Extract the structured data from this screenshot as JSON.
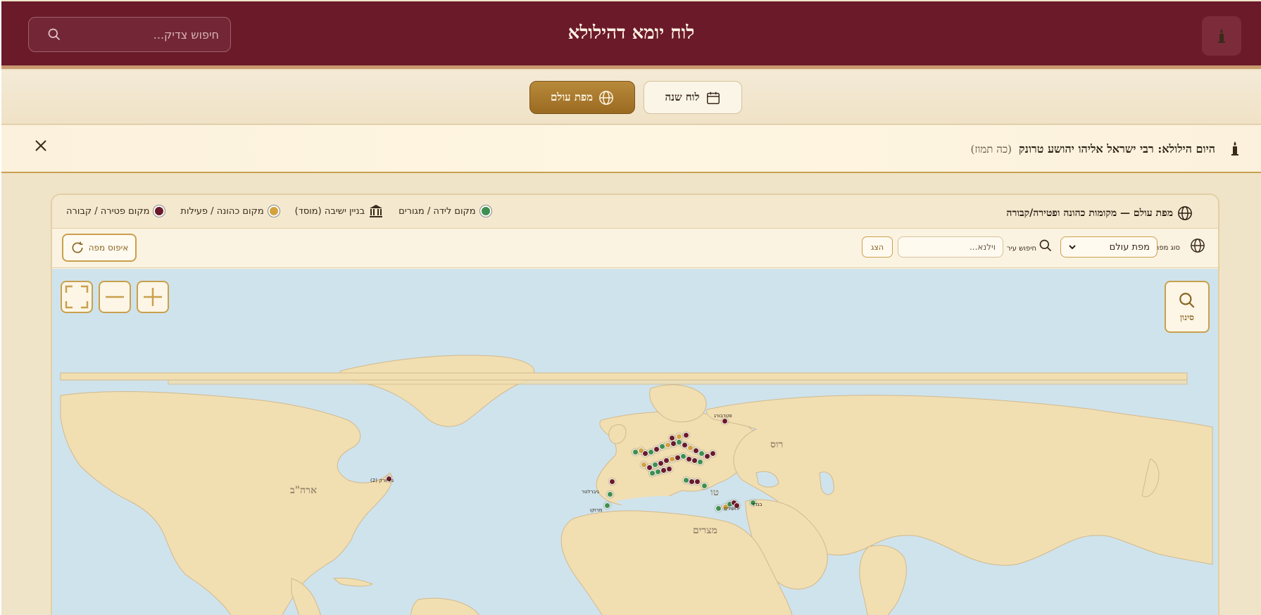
{
  "header": {
    "title": "לוח יומא דהילולא",
    "search_placeholder": "חיפוש צדיק..."
  },
  "nav": {
    "world_map": "מפת עולם",
    "year_calendar": "לוח שנה"
  },
  "announcement": {
    "label": "היום הילולא: רבי ישראל אליהו יהושע טרונק",
    "hebrew_date": "(כה תמוז)"
  },
  "card": {
    "title": "מפת עולם — מקומות כהונה ופטירה/קבורה",
    "legend": [
      {
        "label": "מקום לידה / מגורים",
        "color": "#3f8f4e"
      },
      {
        "label": "בניין ישיבה (מוסד)",
        "color": "icon-building"
      },
      {
        "label": "מקום כהונה / פעילות",
        "color": "#d4a23c"
      },
      {
        "label": "מקום פטירה / קבורה",
        "color": "#6b1a2a"
      }
    ]
  },
  "toolbar": {
    "map_type_label": "סוג מפה",
    "map_type_value": "מפת עולם",
    "city_search_label": "חיפוש עיר",
    "city_placeholder": "וילנא...",
    "show_button": "הצג",
    "reset_button": "איפוס מפה"
  },
  "map": {
    "filter_button": "סינון",
    "labels": {
      "usa": "ארה\"ב",
      "russia": "רוס",
      "egypt": "מצרים",
      "turkey": "טו"
    },
    "marker_labels": [
      "פטרבורג",
      "ניו יורק (2)",
      "גיברלטר",
      "מרוקו",
      "בגדד",
      "ירושלים"
    ]
  },
  "colors": {
    "header": "#6b1a2a",
    "accent_gold": "#b88a3a",
    "birth": "#3f8f4e",
    "service": "#d4a23c",
    "death": "#6b1a2a",
    "ocean": "#cfe3ec",
    "land": "#f1dfb2"
  }
}
